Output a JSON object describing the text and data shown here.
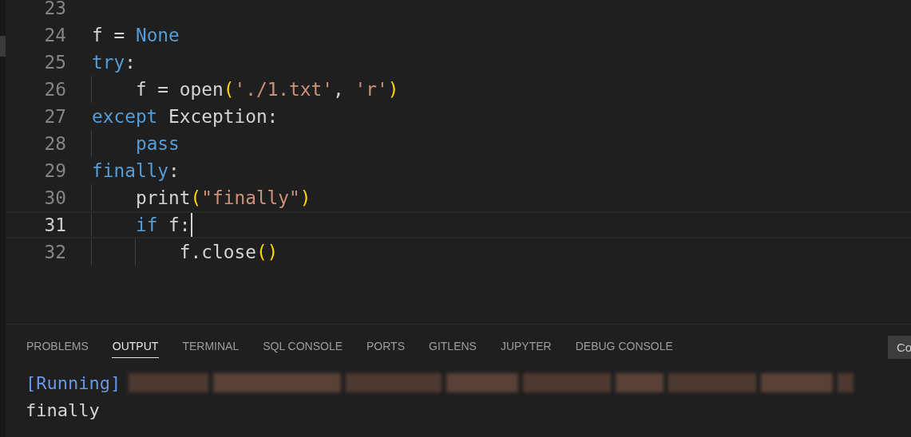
{
  "editor": {
    "lines": [
      {
        "number": "23",
        "current": false
      },
      {
        "number": "24",
        "current": false,
        "tokens": [
          {
            "kind": "plain",
            "text": "f = "
          },
          {
            "kind": "keyword",
            "text": "None"
          }
        ]
      },
      {
        "number": "25",
        "current": false,
        "tokens": [
          {
            "kind": "keyword",
            "text": "try"
          },
          {
            "kind": "plain",
            "text": ":"
          }
        ]
      },
      {
        "number": "26",
        "current": false,
        "tokens": [
          {
            "kind": "plain",
            "text": "    f = open"
          },
          {
            "kind": "bracket",
            "text": "("
          },
          {
            "kind": "string",
            "text": "'./1.txt'"
          },
          {
            "kind": "plain",
            "text": ", "
          },
          {
            "kind": "string",
            "text": "'r'"
          },
          {
            "kind": "bracket",
            "text": ")"
          }
        ]
      },
      {
        "number": "27",
        "current": false,
        "tokens": [
          {
            "kind": "keyword",
            "text": "except"
          },
          {
            "kind": "plain",
            "text": " Exception:"
          }
        ]
      },
      {
        "number": "28",
        "current": false,
        "tokens": [
          {
            "kind": "keyword",
            "text": "    pass"
          }
        ]
      },
      {
        "number": "29",
        "current": false,
        "tokens": [
          {
            "kind": "keyword",
            "text": "finally"
          },
          {
            "kind": "plain",
            "text": ":"
          }
        ]
      },
      {
        "number": "30",
        "current": false,
        "tokens": [
          {
            "kind": "plain",
            "text": "    print"
          },
          {
            "kind": "bracket",
            "text": "("
          },
          {
            "kind": "string",
            "text": "\"finally\""
          },
          {
            "kind": "bracket",
            "text": ")"
          }
        ]
      },
      {
        "number": "31",
        "current": true,
        "tokens": [
          {
            "kind": "keyword",
            "text": "    if"
          },
          {
            "kind": "plain",
            "text": " f:"
          }
        ]
      },
      {
        "number": "32",
        "current": false,
        "tokens": [
          {
            "kind": "plain",
            "text": "        f.close"
          },
          {
            "kind": "bracket",
            "text": "()"
          }
        ]
      }
    ]
  },
  "panel": {
    "tabs": [
      {
        "label": "PROBLEMS",
        "selected": false
      },
      {
        "label": "OUTPUT",
        "selected": true
      },
      {
        "label": "TERMINAL",
        "selected": false
      },
      {
        "label": "SQL CONSOLE",
        "selected": false
      },
      {
        "label": "PORTS",
        "selected": false
      },
      {
        "label": "GITLENS",
        "selected": false
      },
      {
        "label": "JUPYTER",
        "selected": false
      },
      {
        "label": "DEBUG CONSOLE",
        "selected": false
      }
    ],
    "button": "Co",
    "output": [
      {
        "kind": "status",
        "text": "[Running]",
        "redacted": true
      },
      {
        "kind": "plain",
        "text": "finally"
      }
    ]
  }
}
